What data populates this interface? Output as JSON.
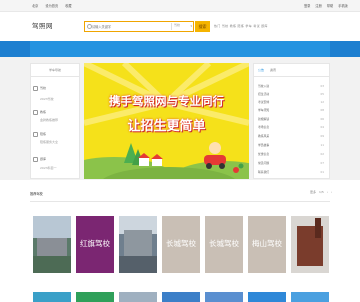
{
  "topbar": {
    "links": [
      "北京",
      "设为首页",
      "收藏"
    ],
    "right": [
      "登录",
      "注册",
      "帮助",
      "手机版"
    ]
  },
  "header": {
    "logo": "驾照网",
    "search_placeholder": "请输入关键字",
    "search_scope": "驾校",
    "search_button": "搜索",
    "hot_words": "热门 驾校 教练 陪练 学车 考试 题库"
  },
  "left_panel": {
    "title": "学车导航",
    "items": [
      {
        "name": "驾校",
        "sub": "2023驾校",
        "icon": "school-icon"
      },
      {
        "name": "教练",
        "sub": "金牌教练推荐",
        "icon": "coach-icon"
      },
      {
        "name": "陪练",
        "sub": "陪练服务大全",
        "icon": "car-icon"
      },
      {
        "name": "题库",
        "sub": "2023科目一",
        "icon": "book-icon"
      }
    ]
  },
  "banner": {
    "line1": "携手驾照网与专业同行",
    "line2": "让招生更简单"
  },
  "right_panel": {
    "tabs": [
      "公告",
      "资讯"
    ],
    "rows": [
      {
        "t": "驾校入驻",
        "v": "03"
      },
      {
        "t": "招生活动",
        "v": "05"
      },
      {
        "t": "考试安排",
        "v": "12"
      },
      {
        "t": "学车须知",
        "v": "08"
      },
      {
        "t": "新规解读",
        "v": "06"
      },
      {
        "t": "考场信息",
        "v": "04"
      },
      {
        "t": "教练风采",
        "v": "09"
      },
      {
        "t": "学员故事",
        "v": "11"
      },
      {
        "t": "优惠信息",
        "v": "02"
      },
      {
        "t": "常见问题",
        "v": "07"
      },
      {
        "t": "联系我们",
        "v": "01"
      }
    ]
  },
  "schools": {
    "title": "推荐驾校",
    "right": [
      "更多",
      "1/5",
      "‹",
      "›"
    ],
    "tiles": [
      {
        "label": "",
        "color": "#5b7a6a"
      },
      {
        "label": "红旗驾校",
        "color": "#7b2672"
      },
      {
        "label": "",
        "color": "#6f7f8e"
      },
      {
        "label": "长城驾校",
        "color": "#c9bfb5"
      },
      {
        "label": "长城驾校",
        "color": "#c9bfb5"
      },
      {
        "label": "梅山驾校",
        "color": "#c9bfb5"
      },
      {
        "label": "",
        "color": "#7a3c2c"
      }
    ],
    "tiles_row2": [
      "#3aa0c8",
      "#2fa05a",
      "#9fb0c0",
      "#3c7fc8",
      "#5a8fd0",
      "#2e88d8",
      "#4aa0e0"
    ]
  },
  "colors": {
    "nav": "#2493e0",
    "accent": "#f5b400",
    "banner": "#f5e11a"
  }
}
